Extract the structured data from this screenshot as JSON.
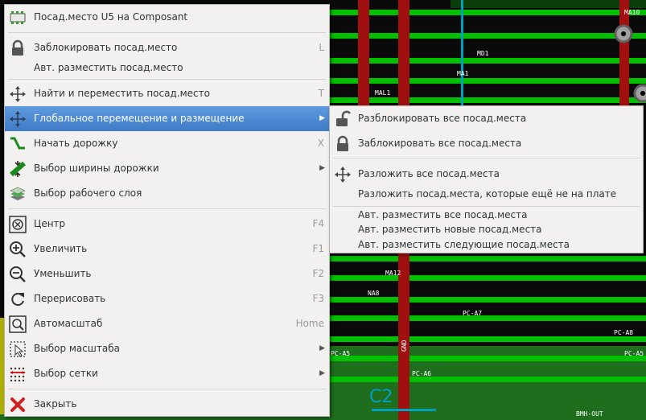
{
  "pcb": {
    "colors": {
      "background": "#000000",
      "copper": "#33aa33",
      "track_green": "#00c000",
      "track_red": "#b00000",
      "track_yellow": "#b0b000",
      "via": "#a0a0a0",
      "cyan": "#00a0c0"
    },
    "net_labels": [
      "MD1",
      "MA1",
      "MAL1",
      "MA10",
      "MA12",
      "NA8",
      "PC-A7",
      "PC-A8",
      "PC-A5",
      "PC-A6",
      "GND",
      "BMH-OUT",
      "C2"
    ]
  },
  "main_menu": {
    "items": [
      {
        "label": "Посад.место U5 на Composant",
        "icon": "footprint-icon",
        "shortcut": "",
        "submenu": false
      },
      {
        "label": "Заблокировать посад.место",
        "icon": "lock-icon",
        "shortcut": "L",
        "submenu": false
      },
      {
        "label": "Авт. разместить посад.место",
        "icon": "",
        "shortcut": "",
        "submenu": false
      },
      {
        "label": "Найти и переместить посад.место",
        "icon": "move-icon",
        "shortcut": "T",
        "submenu": false
      },
      {
        "label": "Глобальное перемещение и размещение",
        "icon": "move-icon",
        "shortcut": "",
        "submenu": true
      },
      {
        "label": "Начать дорожку",
        "icon": "route-track-icon",
        "shortcut": "X",
        "submenu": false
      },
      {
        "label": "Выбор ширины дорожки",
        "icon": "track-width-icon",
        "shortcut": "",
        "submenu": true
      },
      {
        "label": "Выбор рабочего слоя",
        "icon": "layers-icon",
        "shortcut": "",
        "submenu": false
      },
      {
        "label": "Центр",
        "icon": "zoom-center-icon",
        "shortcut": "F4",
        "submenu": false
      },
      {
        "label": "Увеличить",
        "icon": "zoom-in-icon",
        "shortcut": "F1",
        "submenu": false
      },
      {
        "label": "Уменьшить",
        "icon": "zoom-out-icon",
        "shortcut": "F2",
        "submenu": false
      },
      {
        "label": "Перерисовать",
        "icon": "redraw-icon",
        "shortcut": "F3",
        "submenu": false
      },
      {
        "label": "Автомасштаб",
        "icon": "zoom-fit-icon",
        "shortcut": "Home",
        "submenu": false
      },
      {
        "label": "Выбор масштаба",
        "icon": "zoom-select-icon",
        "shortcut": "",
        "submenu": true
      },
      {
        "label": "Выбор сетки",
        "icon": "grid-icon",
        "shortcut": "",
        "submenu": true
      },
      {
        "label": "Закрыть",
        "icon": "close-icon",
        "shortcut": "",
        "submenu": false
      }
    ]
  },
  "sub_menu": {
    "items": [
      {
        "label": "Разблокировать все посад.места",
        "icon": "unlock-icon"
      },
      {
        "label": "Заблокировать все посад.места",
        "icon": "lock-icon"
      },
      {
        "label": "Разложить все посад.места",
        "icon": "move-icon"
      },
      {
        "label": "Разложить посад.места, которые ещё не на плате",
        "icon": ""
      },
      {
        "label": "Авт. разместить все посад.места",
        "icon": ""
      },
      {
        "label": "Авт. разместить новые посад.места",
        "icon": ""
      },
      {
        "label": "Авт. разместить следующие посад.места",
        "icon": ""
      }
    ]
  }
}
